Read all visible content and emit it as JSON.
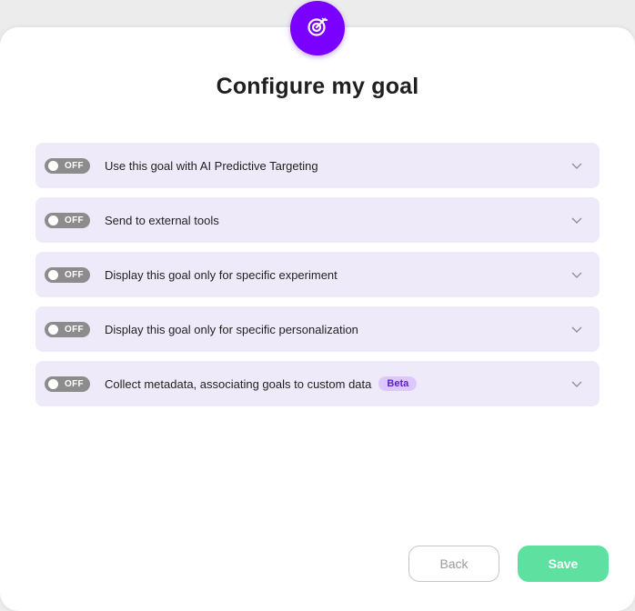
{
  "dialog": {
    "icon": "target-icon",
    "title": "Configure my goal",
    "accent_color": "#7a00ff"
  },
  "options": [
    {
      "toggle_state": "OFF",
      "label": "Use this goal with AI Predictive Targeting"
    },
    {
      "toggle_state": "OFF",
      "label": "Send to external tools"
    },
    {
      "toggle_state": "OFF",
      "label": "Display this goal only for specific experiment"
    },
    {
      "toggle_state": "OFF",
      "label": "Display this goal only for specific personalization"
    },
    {
      "toggle_state": "OFF",
      "label": "Collect metadata, associating goals to custom data",
      "badge": "Beta"
    }
  ],
  "footer": {
    "back_label": "Back",
    "save_label": "Save",
    "save_color": "#5ee0a0"
  }
}
